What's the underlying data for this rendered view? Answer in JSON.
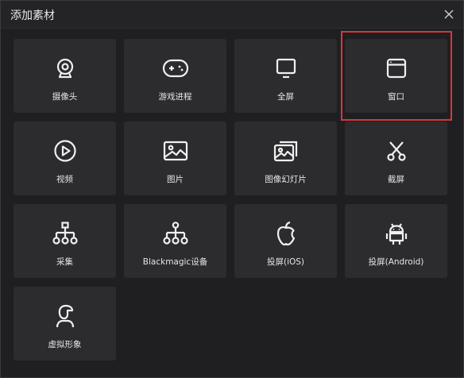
{
  "dialog": {
    "title": "添加素材",
    "close_icon": "close-icon"
  },
  "tiles": [
    {
      "label": "摄像头",
      "icon": "webcam-icon"
    },
    {
      "label": "游戏进程",
      "icon": "gamepad-icon"
    },
    {
      "label": "全屏",
      "icon": "monitor-icon"
    },
    {
      "label": "窗口",
      "icon": "window-icon",
      "highlighted": true
    },
    {
      "label": "视频",
      "icon": "play-circle-icon"
    },
    {
      "label": "图片",
      "icon": "image-icon"
    },
    {
      "label": "图像幻灯片",
      "icon": "slideshow-icon"
    },
    {
      "label": "截屏",
      "icon": "scissors-icon"
    },
    {
      "label": "采集",
      "icon": "hierarchy-icon"
    },
    {
      "label": "Blackmagic设备",
      "icon": "hierarchy-icon"
    },
    {
      "label": "投屏(iOS)",
      "icon": "apple-icon"
    },
    {
      "label": "投屏(Android)",
      "icon": "android-icon"
    },
    {
      "label": "虚拟形象",
      "icon": "avatar-icon"
    }
  ],
  "colors": {
    "background": "#1f1f21",
    "tile": "#2c2c2e",
    "highlight_border": "#d9363e",
    "text": "#e6e6e6"
  }
}
